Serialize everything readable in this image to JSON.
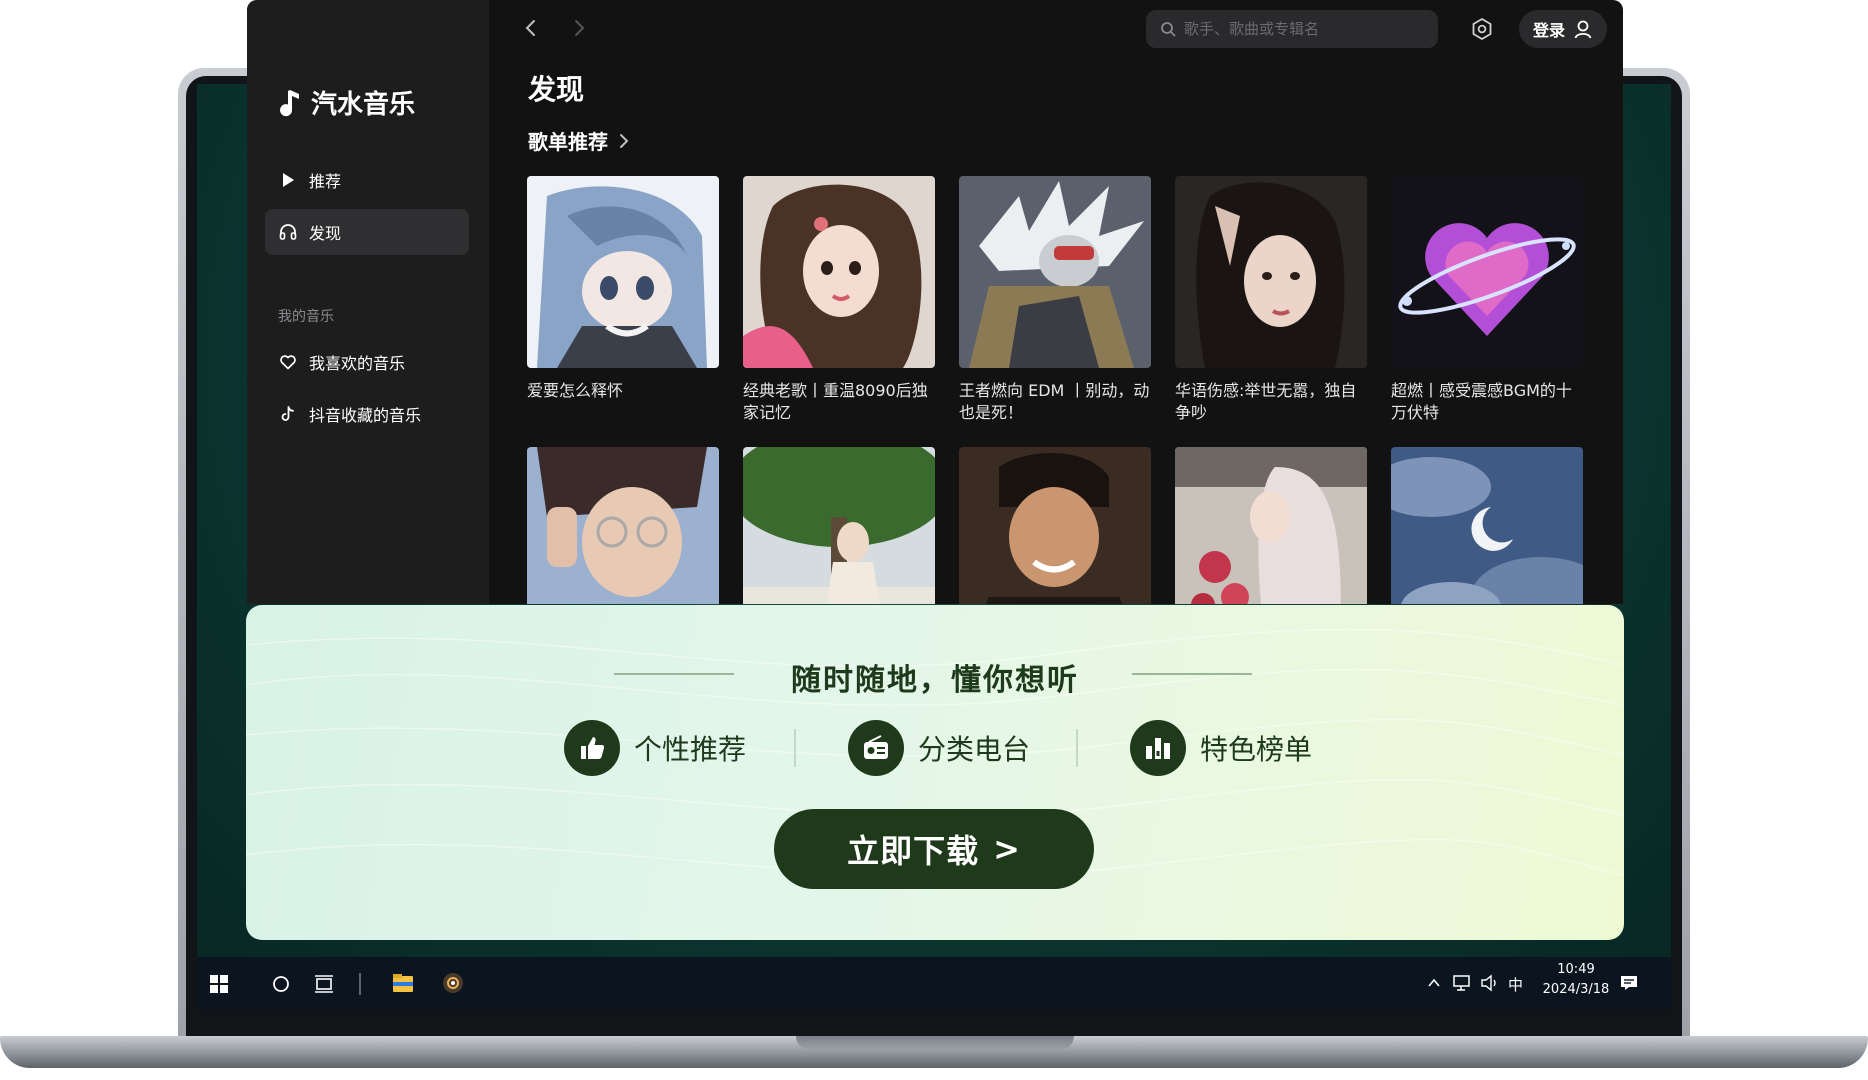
{
  "app": {
    "name": "汽水音乐",
    "nav": [
      {
        "label": "推荐",
        "icon": "play-icon",
        "active": false
      },
      {
        "label": "发现",
        "icon": "headphones-icon",
        "active": true
      }
    ],
    "my_music_label": "我的音乐",
    "my_music": [
      {
        "label": "我喜欢的音乐",
        "icon": "heart-icon"
      },
      {
        "label": "抖音收藏的音乐",
        "icon": "tiktok-icon"
      }
    ],
    "search_placeholder": "歌手、歌曲或专辑名",
    "login_label": "登录",
    "page_title": "发现",
    "section_title": "歌单推荐",
    "playlists_row1": [
      {
        "title": "爱要怎么释怀",
        "cover": "anime-blue-hair"
      },
      {
        "title": "经典老歌丨重温8090后独家记忆",
        "cover": "girl-curly-hair"
      },
      {
        "title": "王者燃向 EDM 丨别动，动也是死！",
        "cover": "anime-warrior"
      },
      {
        "title": "华语伤感:举世无嚣，独自争吵",
        "cover": "girl-dark-portrait"
      },
      {
        "title": "超燃丨感受震感BGM的十万伏特",
        "cover": "purple-heart"
      }
    ],
    "playlists_row2": [
      {
        "cover": "anime-glasses-man"
      },
      {
        "cover": "girl-under-tree"
      },
      {
        "cover": "retro-man-portrait"
      },
      {
        "cover": "girl-with-roses"
      },
      {
        "cover": "moon-clouds"
      }
    ]
  },
  "promo": {
    "heading": "随时随地，懂你想听",
    "features": [
      {
        "label": "个性推荐",
        "icon": "thumbs-up-icon"
      },
      {
        "label": "分类电台",
        "icon": "radio-icon"
      },
      {
        "label": "特色榜单",
        "icon": "chart-bars-icon"
      }
    ],
    "download_label": "立即下载",
    "download_arrow": ">"
  },
  "taskbar": {
    "time": "10:49",
    "date": "2024/3/18",
    "ime": "中"
  },
  "colors": {
    "accent_dark_green": "#1f3a1a",
    "app_bg": "#121212",
    "sidebar_bg": "#1d1d1e"
  }
}
